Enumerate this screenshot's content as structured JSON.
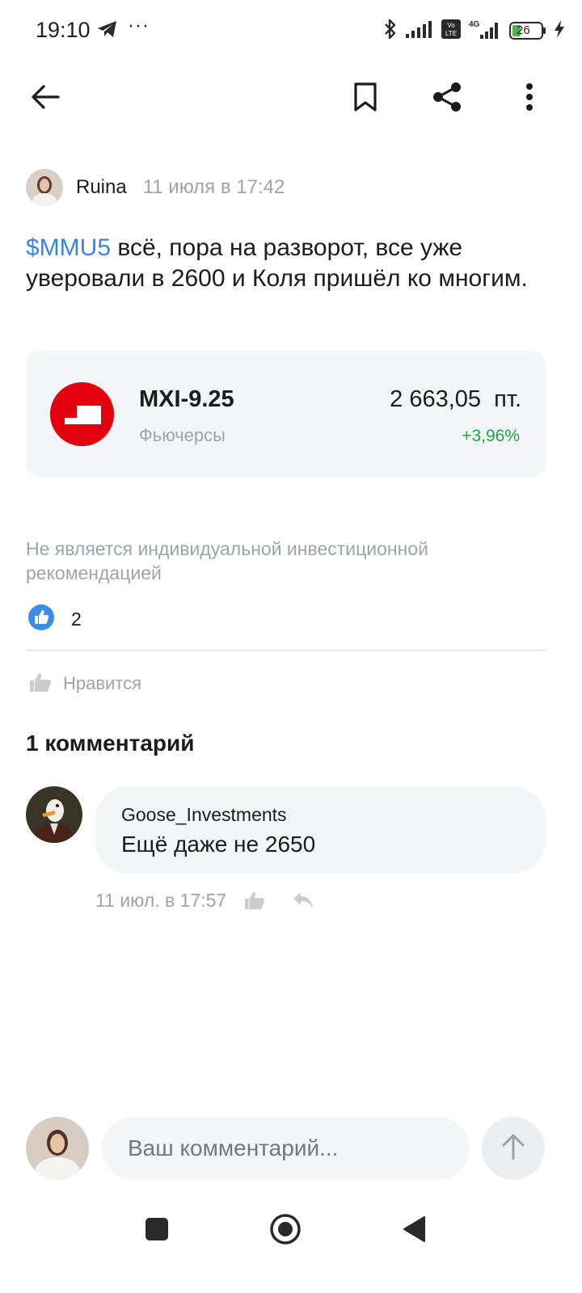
{
  "status_bar": {
    "time": "19:10",
    "dots": "···",
    "battery": "26",
    "icons": [
      "telegram-icon",
      "bluetooth-icon",
      "signal-icon",
      "volte-icon",
      "4g-icon",
      "battery-icon",
      "charging-icon"
    ]
  },
  "top_bar": {
    "icons": [
      "back-arrow-icon",
      "bookmark-icon",
      "share-icon",
      "more-vertical-icon"
    ]
  },
  "post": {
    "author": "Ruina",
    "date": "11 июля в 17:42",
    "ticker": "$MMU5",
    "text": " всё, пора на разворот, все уже уверовали в 2600 и Коля пришёл ко многим.",
    "instrument": {
      "name": "MXI-9.25",
      "type": "Фьючерсы",
      "price": "2 663,05  пт.",
      "change": "+3,96%",
      "change_color": "#1fa340",
      "logo_color": "#e3000f"
    },
    "disclaimer": "Не является индивидуальной инвестиционной рекомендацией",
    "reaction_count": "2",
    "like_label": "Нравится"
  },
  "comments": {
    "title": "1 комментарий",
    "items": [
      {
        "author": "Goose_Investments",
        "text": "Ещё даже не 2650",
        "date": "11 июл. в 17:57"
      }
    ]
  },
  "comment_input": {
    "placeholder": "Ваш комментарий..."
  },
  "colors": {
    "accent": "#3a84e2",
    "positive": "#1fa340",
    "muted": "#9ea3ab"
  }
}
